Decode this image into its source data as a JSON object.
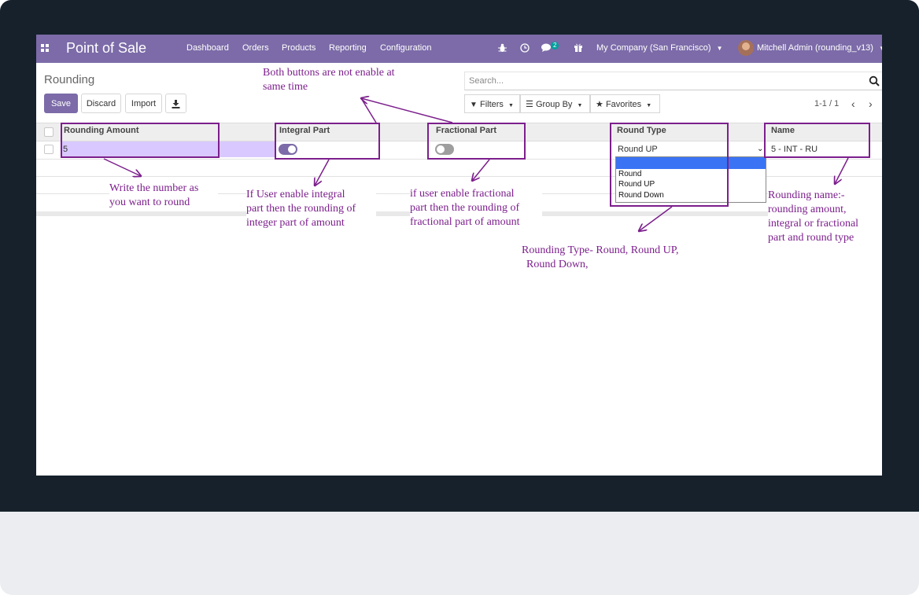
{
  "navbar": {
    "app_title": "Point of Sale",
    "menu": [
      "Dashboard",
      "Orders",
      "Products",
      "Reporting",
      "Configuration"
    ],
    "chat_badge": "2",
    "company": "My Company (San Francisco)",
    "user": "Mitchell Admin (rounding_v13)",
    "color": "#7c6ba8"
  },
  "page": {
    "title": "Rounding",
    "buttons": {
      "save": "Save",
      "discard": "Discard",
      "import": "Import"
    },
    "search_placeholder": "Search...",
    "filters": {
      "filters": "Filters",
      "group_by": "Group By",
      "favorites": "Favorites"
    },
    "pager": "1-1 / 1"
  },
  "table": {
    "headers": [
      "Rounding Amount",
      "Integral Part",
      "Fractional Part",
      "Round Type",
      "Name"
    ],
    "row": {
      "rounding_amount": "5",
      "integral_part": true,
      "fractional_part": false,
      "round_type": "Round UP",
      "name": "5 - INT - RU"
    }
  },
  "round_type_options": [
    "",
    "Round",
    "Round UP",
    "Round Down"
  ],
  "annotations": {
    "both_buttons": [
      "Both buttons are not enable at",
      "same time"
    ],
    "write_number": [
      "Write the number as",
      "you want to round"
    ],
    "integral": [
      "If User enable integral",
      "part then the rounding of",
      "integer part of amount"
    ],
    "fractional": [
      "if user enable fractional",
      "part then the rounding of",
      "fractional part of amount"
    ],
    "round_type": [
      "Rounding Type- Round, Round UP,",
      "Round Down,"
    ],
    "name": [
      "Rounding name:-",
      "rounding amount,",
      "integral or fractional",
      "part and round type"
    ],
    "color": "#7c1f8c"
  }
}
